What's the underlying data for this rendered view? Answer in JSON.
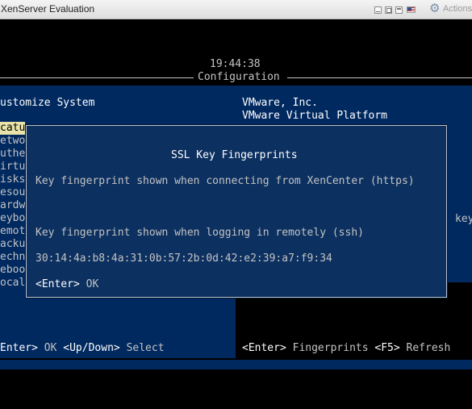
{
  "window": {
    "title": "XenServer Evaluation",
    "actions_label": "Actions",
    "icons": [
      "minimize-icon",
      "restore-icon",
      "maximize-icon",
      "flag-icon",
      "gear-icon"
    ]
  },
  "console": {
    "clock": "19:44:38",
    "header_title": "Configuration",
    "left_title": "ustomize System",
    "menu_items": [
      "catu",
      "etwo",
      "uthe",
      "irtu",
      "isks",
      "esou",
      "ardw",
      "eybo",
      "emot",
      "acku",
      "echn",
      "eboo",
      "ocal"
    ],
    "right_lines": [
      "VMware, Inc.",
      "VMware Virtual Platform"
    ],
    "right_partial": "key",
    "left_footer": {
      "enter_key": "Enter>",
      "enter_label": "OK",
      "updown_key": "<Up/Down>",
      "updown_label": "Select"
    },
    "right_footer": {
      "enter_key": "<Enter>",
      "enter_label": "Fingerprints",
      "f5_key": "<F5>",
      "f5_label": "Refresh"
    }
  },
  "dialog": {
    "title": "SSL Key Fingerprints",
    "https_label": "Key fingerprint shown when connecting from XenCenter (https)",
    "https_value": "",
    "ssh_label": "Key fingerprint shown when logging in remotely (ssh)",
    "ssh_value": "30:14:4a:b8:4a:31:0b:57:2b:0d:42:e2:39:a7:f9:34",
    "ok_key": "<Enter>",
    "ok_label": "OK"
  },
  "colors": {
    "console_bg": "#000000",
    "pane_bg": "#002960",
    "dialog_bg": "#0c3060",
    "selected_bg": "#e8e3a8"
  }
}
